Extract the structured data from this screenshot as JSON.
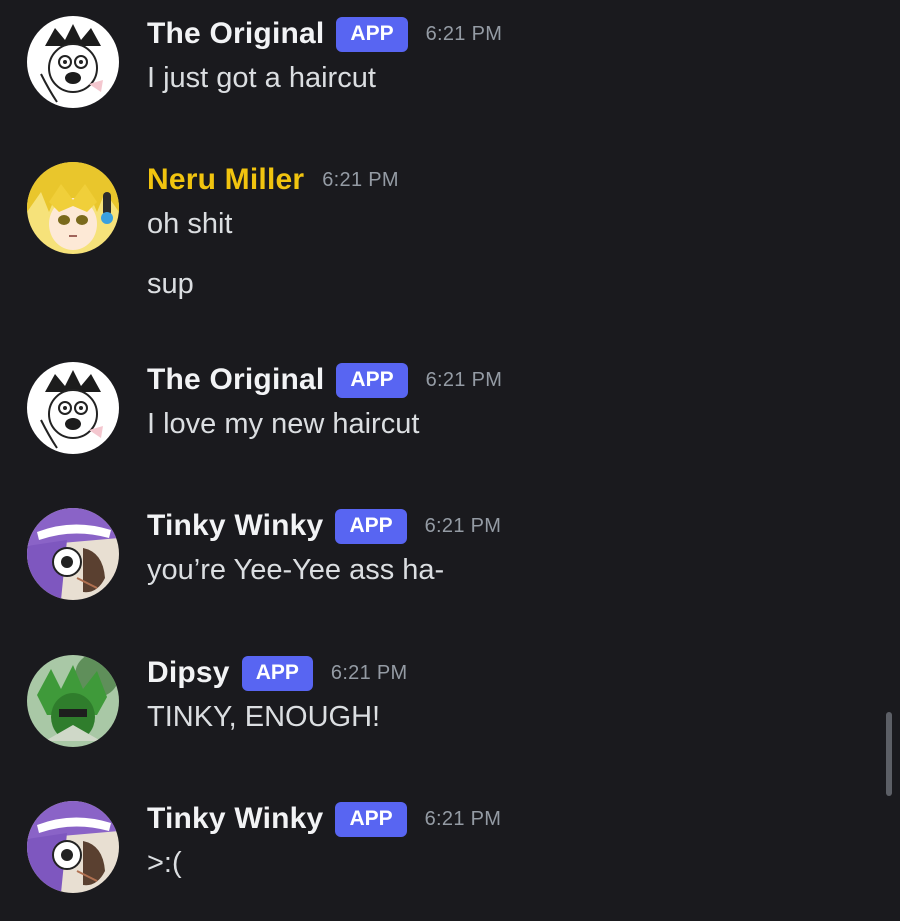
{
  "app_badge": "APP",
  "messages": [
    {
      "username": "The Original",
      "username_color": "#f2f3f5",
      "badge": "APP",
      "time": "6:21 PM",
      "avatar": "the-original-avatar",
      "lines": [
        "I just got a haircut"
      ]
    },
    {
      "username": "Neru Miller",
      "username_color": "#f1c40f",
      "time": "6:21 PM",
      "avatar": "neru-miller-avatar",
      "lines": [
        "oh shit",
        "sup"
      ]
    },
    {
      "username": "The Original",
      "username_color": "#f2f3f5",
      "badge": "APP",
      "time": "6:21 PM",
      "avatar": "the-original-avatar",
      "lines": [
        "I love my new haircut"
      ]
    },
    {
      "username": "Tinky Winky",
      "username_color": "#f2f3f5",
      "badge": "APP",
      "time": "6:21 PM",
      "avatar": "tinky-winky-avatar",
      "lines": [
        "you’re Yee-Yee ass ha-"
      ]
    },
    {
      "username": "Dipsy",
      "username_color": "#f2f3f5",
      "badge": "APP",
      "time": "6:21 PM",
      "avatar": "dipsy-avatar",
      "lines": [
        "TINKY, ENOUGH!"
      ]
    },
    {
      "username": "Tinky Winky",
      "username_color": "#f2f3f5",
      "badge": "APP",
      "time": "6:21 PM",
      "avatar": "tinky-winky-avatar",
      "lines": [
        ">:("
      ]
    }
  ],
  "colors": {
    "background": "#1a1a1e",
    "badge": "#5865f2",
    "timestamp": "#949ba4",
    "message_text": "#dbdee1",
    "highlight_name": "#f1c40f"
  }
}
